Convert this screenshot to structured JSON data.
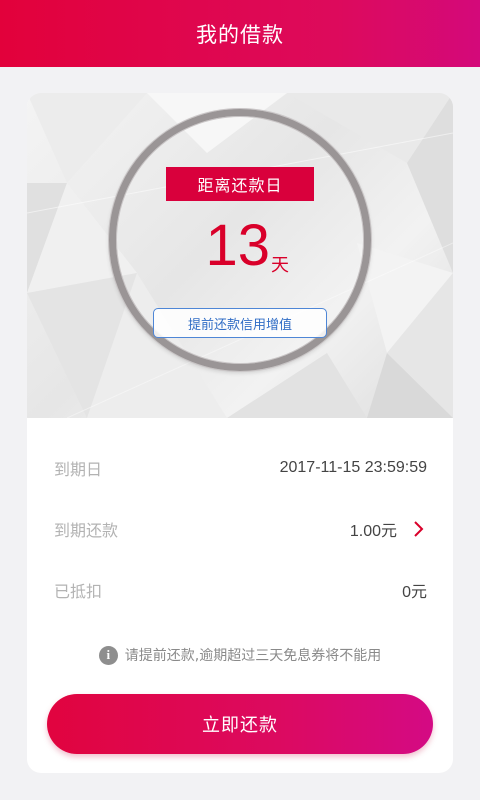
{
  "header": {
    "title": "我的借款"
  },
  "hero": {
    "due_banner": "距离还款日",
    "days_value": "13",
    "days_unit": "天",
    "credit_button": "提前还款信用增值"
  },
  "details": {
    "rows": [
      {
        "label": "到期日",
        "value": "2017-11-15 23:59:59"
      },
      {
        "label": "到期还款",
        "value": "1.00元"
      },
      {
        "label": "已抵扣",
        "value": "0元"
      }
    ]
  },
  "notice": {
    "icon": "info-icon",
    "text": "请提前还款,逾期超过三天免息券将不能用"
  },
  "actions": {
    "repay_label": "立即还款"
  },
  "colors": {
    "brand_red": "#d9003c",
    "accent_pink": "#d40a84",
    "link_blue": "#2f6cc5"
  }
}
